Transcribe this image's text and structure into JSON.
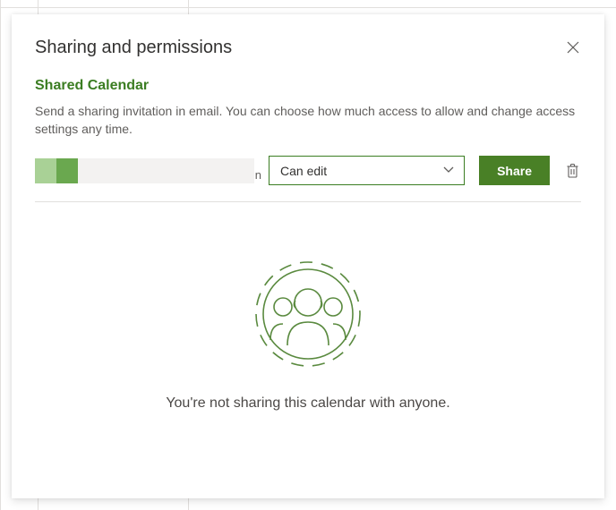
{
  "dialog": {
    "title": "Sharing and permissions",
    "subtitle": "Shared Calendar",
    "description": "Send a sharing invitation in email. You can choose how much access to allow and change access settings any time."
  },
  "invite": {
    "person_suffix": "n",
    "permission_selected": "Can edit",
    "share_label": "Share"
  },
  "empty": {
    "message": "You're not sharing this calendar with anyone."
  },
  "colors": {
    "accent": "#3b7d22",
    "button": "#498026"
  }
}
